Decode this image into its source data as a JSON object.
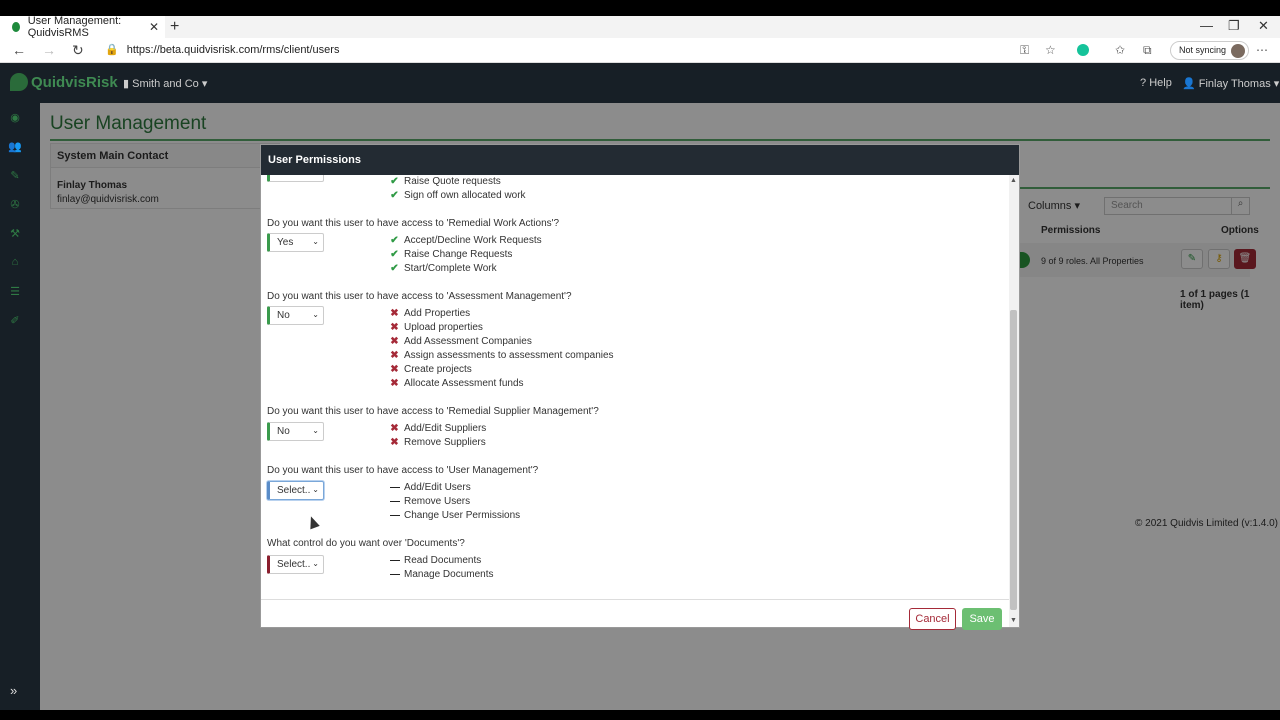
{
  "browser": {
    "tab_title": "User Management: QuidvisRMS",
    "tab_close": "✕",
    "new_tab": "+",
    "url": "https://beta.quidvisrisk.com/rms/client/users",
    "sync_label": "Not syncing",
    "window_controls": [
      "—",
      "❐",
      "✕"
    ]
  },
  "app": {
    "logo_text": "QuidvisRisk",
    "org_label": "Smith and Co",
    "help_label": "Help",
    "user_label": "Finlay Thomas"
  },
  "page": {
    "title": "User Management",
    "contact_header": "System Main Contact",
    "contact_name": "Finlay Thomas",
    "contact_email": "finlay@quidvisrisk.com",
    "columns_label": "Columns",
    "search_placeholder": "Search",
    "col_permissions": "Permissions",
    "col_options": "Options",
    "row_permissions": "9 of 9 roles. All Properties",
    "pager": "1 of 1 pages (1 item)",
    "copyright": "© 2021 Quidvis Limited (v:1.4.0)"
  },
  "modal": {
    "title": "User Permissions",
    "top_perms": [
      "Raise Quote requests",
      "Sign off own allocated work"
    ],
    "sections": [
      {
        "question": "Do you want this user to have access to 'Remedial Work Actions'?",
        "value": "Yes",
        "perms": [
          "Accept/Decline Work Requests",
          "Raise Change Requests",
          "Start/Complete Work"
        ]
      },
      {
        "question": "Do you want this user to have access to 'Assessment Management'?",
        "value": "No",
        "perms": [
          "Add Properties",
          "Upload properties",
          "Add Assessment Companies",
          "Assign assessments to assessment companies",
          "Create projects",
          "Allocate Assessment funds"
        ]
      },
      {
        "question": "Do you want this user to have access to 'Remedial Supplier Management'?",
        "value": "No",
        "perms": [
          "Add/Edit Suppliers",
          "Remove Suppliers"
        ]
      },
      {
        "question": "Do you want this user to have access to 'User Management'?",
        "value": "Select..",
        "perms": [
          "Add/Edit Users",
          "Remove Users",
          "Change User Permissions"
        ]
      },
      {
        "question": "What control do you want over 'Documents'?",
        "value": "Select..",
        "perms": [
          "Read Documents",
          "Manage Documents"
        ]
      }
    ],
    "cancel_label": "Cancel",
    "save_label": "Save"
  },
  "colors": {
    "brand_green": "#2e7a3f",
    "header_dark": "#171f26",
    "danger": "#a52a38",
    "save_green": "#6cbf72"
  }
}
